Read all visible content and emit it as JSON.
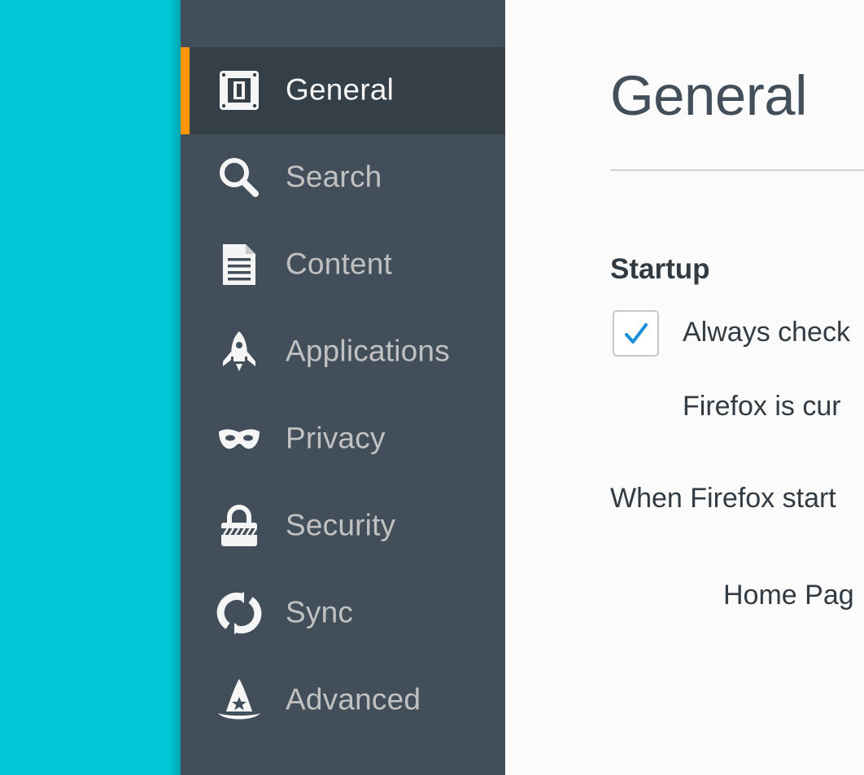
{
  "sidebar": {
    "items": [
      {
        "label": "General",
        "icon": "general-icon",
        "selected": true
      },
      {
        "label": "Search",
        "icon": "search-icon",
        "selected": false
      },
      {
        "label": "Content",
        "icon": "document-icon",
        "selected": false
      },
      {
        "label": "Applications",
        "icon": "rocket-icon",
        "selected": false
      },
      {
        "label": "Privacy",
        "icon": "mask-icon",
        "selected": false
      },
      {
        "label": "Security",
        "icon": "lock-icon",
        "selected": false
      },
      {
        "label": "Sync",
        "icon": "sync-icon",
        "selected": false
      },
      {
        "label": "Advanced",
        "icon": "wizard-hat-icon",
        "selected": false
      }
    ]
  },
  "main": {
    "title": "General",
    "startup": {
      "heading": "Startup",
      "default_check_label": "Always check",
      "default_check_checked": true,
      "current_status": "Firefox is cur",
      "when_starts_label": "When Firefox start",
      "home_page_label": "Home Pag"
    }
  },
  "colors": {
    "backdrop": "#00c8d6",
    "sidebar": "#424f5a",
    "sidebar_selected": "#343f48",
    "accent": "#ff9500",
    "checkmark": "#1a8fd9"
  }
}
